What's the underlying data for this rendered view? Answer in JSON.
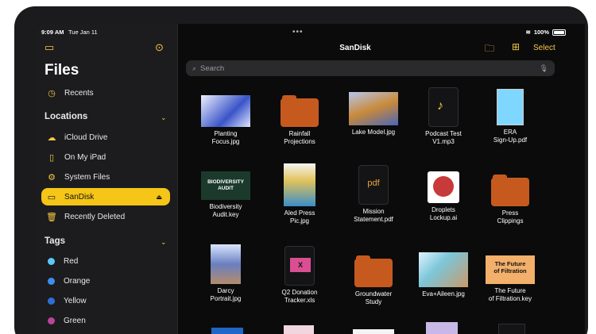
{
  "status": {
    "time": "9:09 AM",
    "date": "Tue Jan 11",
    "battery": "100%"
  },
  "sidebar": {
    "title": "Files",
    "recents": "Recents",
    "locations_header": "Locations",
    "locations": [
      {
        "label": "iCloud Drive",
        "icon": "cloud-icon"
      },
      {
        "label": "On My iPad",
        "icon": "ipad-icon"
      },
      {
        "label": "System Files",
        "icon": "gear-icon"
      },
      {
        "label": "SanDisk",
        "icon": "drive-icon",
        "active": true
      },
      {
        "label": "Recently Deleted",
        "icon": "trash-icon"
      }
    ],
    "tags_header": "Tags",
    "tags": [
      {
        "label": "Red",
        "color": "#5ac8fa"
      },
      {
        "label": "Orange",
        "color": "#3b8ef0"
      },
      {
        "label": "Yellow",
        "color": "#2d6fd6"
      },
      {
        "label": "Green",
        "color": "#b9449b"
      }
    ]
  },
  "toolbar": {
    "title": "SanDisk",
    "select": "Select"
  },
  "search": {
    "placeholder": "Search"
  },
  "files": [
    {
      "name": "Planting\nFocus.jpg",
      "kind": "image"
    },
    {
      "name": "Rainfall\nProjections",
      "kind": "folder"
    },
    {
      "name": "Lake Model.jpg",
      "kind": "image"
    },
    {
      "name": "Podcast Test\nV1.mp3",
      "kind": "audio"
    },
    {
      "name": "ERA\nSign-Up.pdf",
      "kind": "pdf-image"
    },
    {
      "name": "Biodiversity\nAudit.key",
      "kind": "keynote",
      "thumb_text": "BIODIVERSITY\nAUDIT"
    },
    {
      "name": "Aled Press\nPic.jpg",
      "kind": "image"
    },
    {
      "name": "Mission\nStatement.pdf",
      "kind": "pdf",
      "thumb_text": "pdf"
    },
    {
      "name": "Droplets\nLockup.ai",
      "kind": "ai"
    },
    {
      "name": "Press\nClippings",
      "kind": "folder"
    },
    {
      "name": "Darcy\nPortrait.jpg",
      "kind": "image"
    },
    {
      "name": "Q2 Donation\nTracker.xls",
      "kind": "xls"
    },
    {
      "name": "Groundwater\nStudy",
      "kind": "folder"
    },
    {
      "name": "Eva+Aileen.jpg",
      "kind": "image"
    },
    {
      "name": "The Future\nof Filtration.key",
      "kind": "keynote2",
      "thumb_text": "The Future\nof Filtration"
    }
  ]
}
